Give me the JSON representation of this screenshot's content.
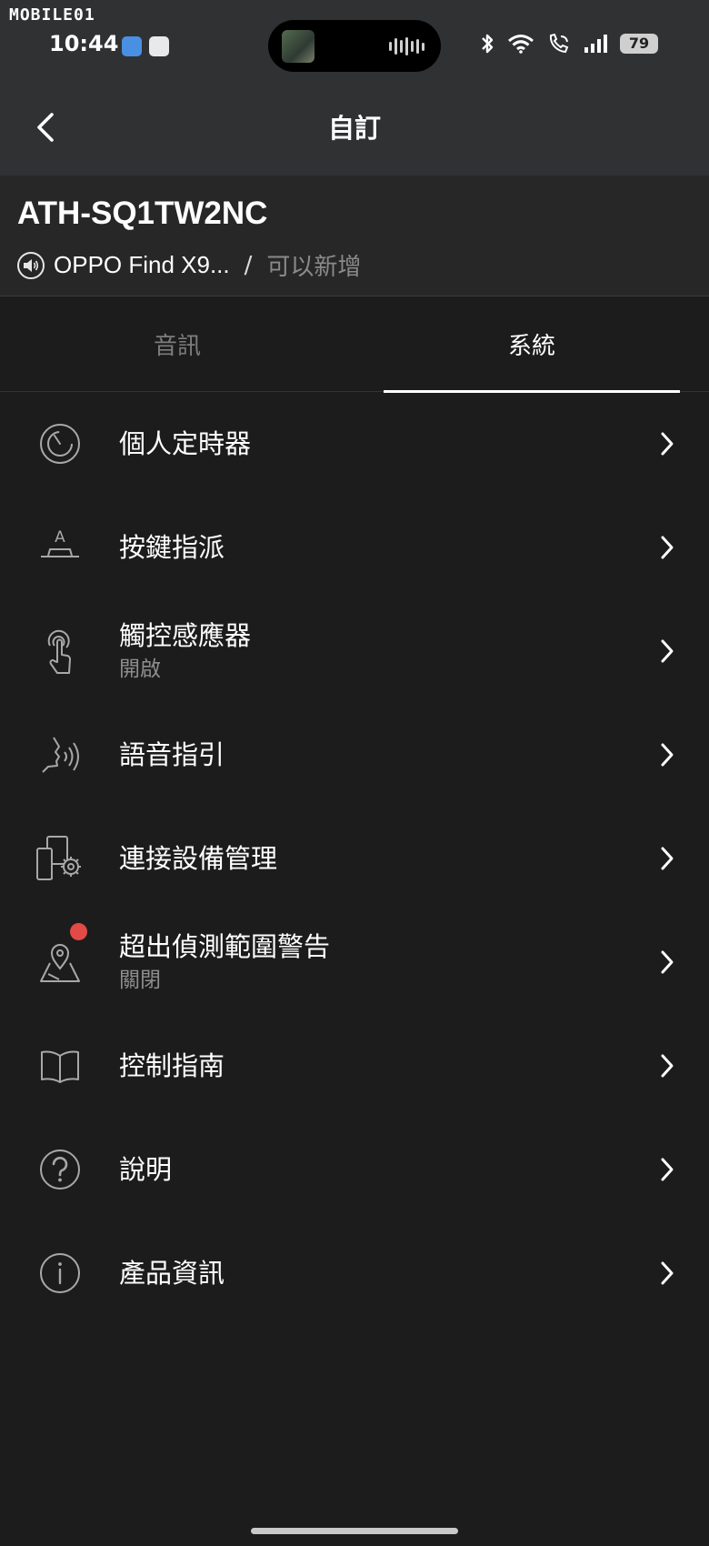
{
  "status_bar": {
    "watermark": "MOBILE01",
    "time": "10:44",
    "battery": "79",
    "icons": [
      "weather-icon",
      "app-icon",
      "bluetooth-icon",
      "wifi-icon",
      "wifi-call-icon",
      "signal-icon",
      "battery-icon"
    ]
  },
  "nav": {
    "title": "自訂",
    "back_icon": "chevron-left-icon"
  },
  "device": {
    "name": "ATH-SQ1TW2NC",
    "connected_to": "OPPO Find X9...",
    "separator": "/",
    "add_label": "可以新增"
  },
  "tabs": [
    {
      "label": "音訊",
      "active": false
    },
    {
      "label": "系統",
      "active": true
    }
  ],
  "menu": [
    {
      "label": "個人定時器",
      "icon": "timer-icon"
    },
    {
      "label": "按鍵指派",
      "icon": "button-assign-icon"
    },
    {
      "label": "觸控感應器",
      "sublabel": "開啟",
      "icon": "touch-sensor-icon"
    },
    {
      "label": "語音指引",
      "icon": "voice-guide-icon"
    },
    {
      "label": "連接設備管理",
      "icon": "device-manage-icon"
    },
    {
      "label": "超出偵測範圍警告",
      "sublabel": "關閉",
      "icon": "map-pin-icon",
      "notification": true
    },
    {
      "label": "控制指南",
      "icon": "book-icon"
    },
    {
      "label": "說明",
      "icon": "help-icon"
    },
    {
      "label": "產品資訊",
      "icon": "info-icon"
    }
  ],
  "colors": {
    "background": "#1c1c1c",
    "header": "#2f3133",
    "device_header": "#272727",
    "text_primary": "#ffffff",
    "text_secondary": "#8e8e8e",
    "notification_dot": "#e34a45"
  }
}
